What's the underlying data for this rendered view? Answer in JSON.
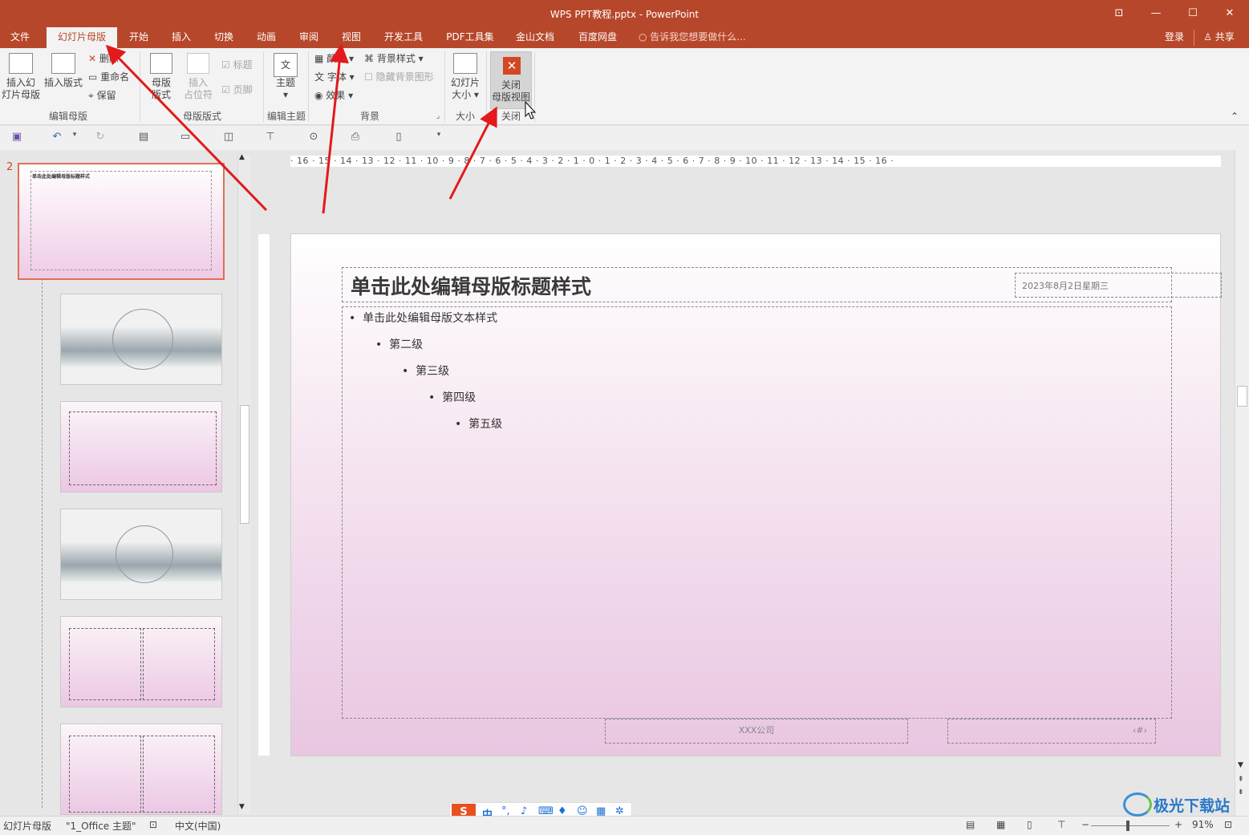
{
  "window": {
    "title": "WPS PPT教程.pptx - PowerPoint",
    "controls": [
      "⊡",
      "—",
      "☐",
      "✕"
    ]
  },
  "menu": {
    "tabs": [
      "文件",
      "幻灯片母版",
      "开始",
      "插入",
      "切换",
      "动画",
      "审阅",
      "视图",
      "开发工具",
      "PDF工具集",
      "金山文档",
      "百度网盘"
    ],
    "tell_me": "告诉我您想要做什么...",
    "login": "登录",
    "share": "共享"
  },
  "ribbon": {
    "edit_master": {
      "insert_master": "插入幻灯片母版",
      "insert_master_l1": "插入幻",
      "insert_master_l2": "灯片母版",
      "insert_layout": "插入版式",
      "delete": "删除",
      "rename": "重命名",
      "preserve": "保留",
      "group": "编辑母版"
    },
    "master_layout": {
      "master_layout": "母版版式",
      "ml_l1": "母版",
      "ml_l2": "版式",
      "insert_placeholder_l1": "插入",
      "insert_placeholder_l2": "占位符",
      "title": "标题",
      "footer": "页脚",
      "group": "母版版式"
    },
    "edit_theme": {
      "themes": "主题",
      "group": "编辑主题"
    },
    "background": {
      "colors": "颜色",
      "fonts": "字体",
      "effects": "效果",
      "bg_styles": "背景样式",
      "hide_bg": "隐藏背景图形",
      "group": "背景"
    },
    "size": {
      "slide_size_l1": "幻灯片",
      "slide_size_l2": "大小",
      "group": "大小"
    },
    "close": {
      "close_l1": "关闭",
      "close_l2": "母版视图",
      "group": "关闭"
    }
  },
  "panel": {
    "slide_number": "2",
    "first_title": "单击此处编辑母版标题样式"
  },
  "ruler": {
    "h": "· 16 · 15 · 14 · 13 · 12 · 11 · 10 · 9 · 8 · 7 · 6 · 5 · 4 · 3 · 2 · 1 · 0 · 1 · 2 · 3 · 4 · 5 · 6 · 7 · 8 · 9 · 10 · 11 · 12 · 13 · 14 · 15 · 16 ·"
  },
  "slide": {
    "title": "单击此处编辑母版标题样式",
    "date": "2023年8月2日星期三",
    "l1": "单击此处编辑母版文本样式",
    "l2": "第二级",
    "l3": "第三级",
    "l4": "第四级",
    "l5": "第五级",
    "footer": "XXX公司",
    "page": "‹#›"
  },
  "status": {
    "view": "幻灯片母版",
    "theme": "\"1_Office 主题\"",
    "lang": "中文(中国)",
    "zoom": "91%"
  },
  "ime": {
    "label": "中"
  },
  "watermark": "极光下载站"
}
